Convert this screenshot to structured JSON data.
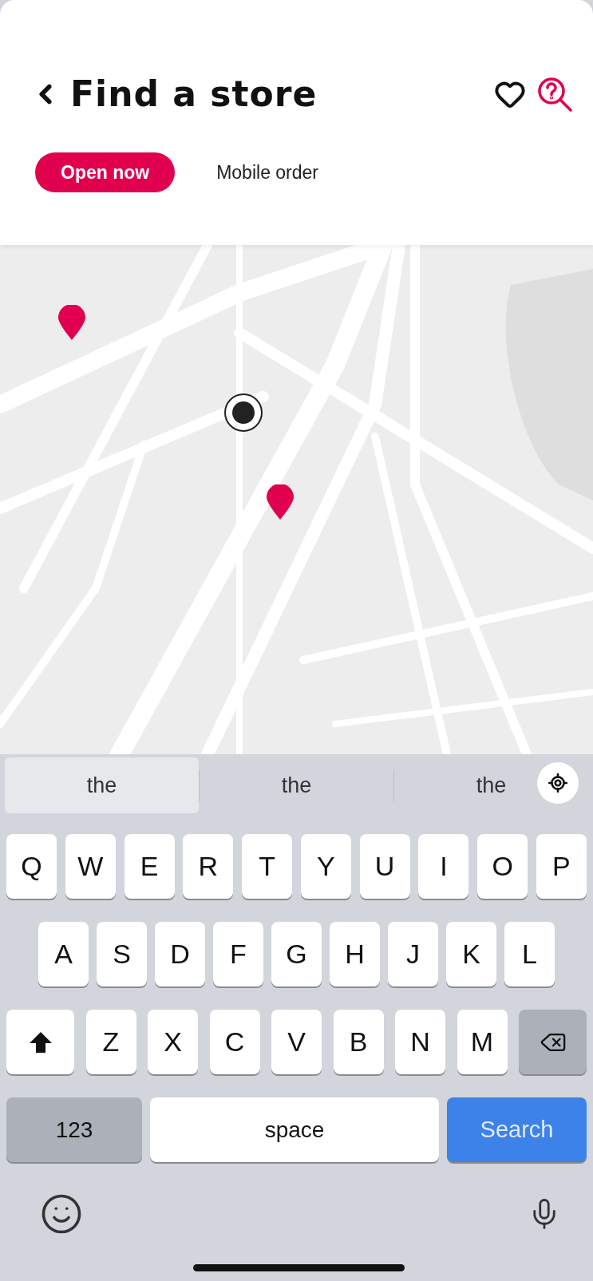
{
  "header": {
    "title": "Find a store"
  },
  "filters": [
    {
      "label": "Open now",
      "selected": true
    },
    {
      "label": "Mobile order",
      "selected": false
    }
  ],
  "keyboard": {
    "suggestions": [
      "the",
      "the",
      "the"
    ],
    "rows": [
      {
        "keys": [
          {
            "kind": "letter",
            "label": "Q"
          },
          {
            "kind": "letter",
            "label": "W"
          },
          {
            "kind": "letter",
            "label": "E"
          },
          {
            "kind": "letter",
            "label": "R"
          },
          {
            "kind": "letter",
            "label": "T"
          },
          {
            "kind": "letter",
            "label": "Y"
          },
          {
            "kind": "letter",
            "label": "U"
          },
          {
            "kind": "letter",
            "label": "I"
          },
          {
            "kind": "letter",
            "label": "O"
          },
          {
            "kind": "letter",
            "label": "P"
          }
        ]
      },
      {
        "keys": [
          {
            "kind": "letter",
            "label": "A"
          },
          {
            "kind": "letter",
            "label": "S"
          },
          {
            "kind": "letter",
            "label": "D"
          },
          {
            "kind": "letter",
            "label": "F"
          },
          {
            "kind": "letter",
            "label": "G"
          },
          {
            "kind": "letter",
            "label": "H"
          },
          {
            "kind": "letter",
            "label": "J"
          },
          {
            "kind": "letter",
            "label": "K"
          },
          {
            "kind": "letter",
            "label": "L"
          }
        ]
      },
      {
        "keys": [
          {
            "kind": "shift"
          },
          {
            "kind": "letter",
            "label": "Z"
          },
          {
            "kind": "letter",
            "label": "X"
          },
          {
            "kind": "letter",
            "label": "C"
          },
          {
            "kind": "letter",
            "label": "V"
          },
          {
            "kind": "letter",
            "label": "B"
          },
          {
            "kind": "letter",
            "label": "N"
          },
          {
            "kind": "letter",
            "label": "M"
          },
          {
            "kind": "backspace"
          }
        ]
      },
      {
        "keys": [
          {
            "kind": "mode",
            "label": "123"
          },
          {
            "kind": "space",
            "label": "space"
          },
          {
            "kind": "action",
            "label": "Search"
          }
        ]
      }
    ]
  }
}
